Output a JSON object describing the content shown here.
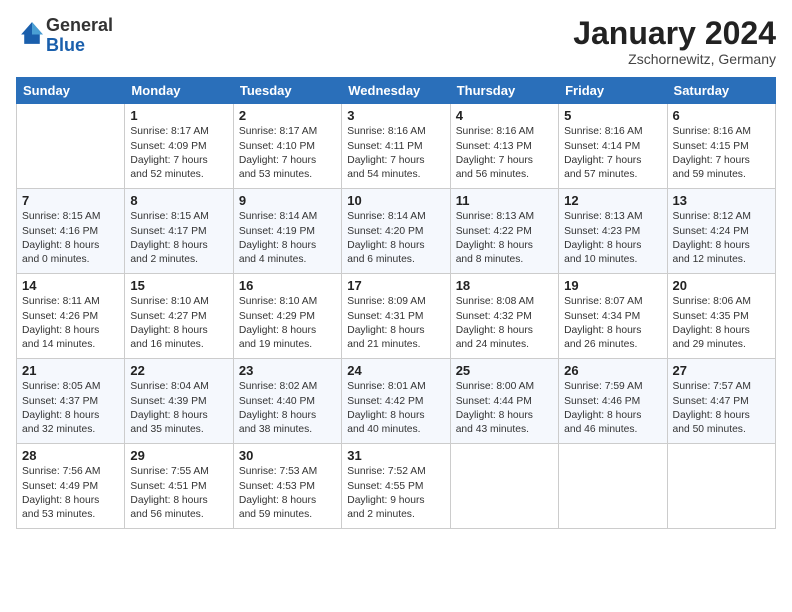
{
  "header": {
    "logo_general": "General",
    "logo_blue": "Blue",
    "month_title": "January 2024",
    "subtitle": "Zschornewitz, Germany"
  },
  "days_of_week": [
    "Sunday",
    "Monday",
    "Tuesday",
    "Wednesday",
    "Thursday",
    "Friday",
    "Saturday"
  ],
  "weeks": [
    [
      {
        "day": "",
        "lines": []
      },
      {
        "day": "1",
        "lines": [
          "Sunrise: 8:17 AM",
          "Sunset: 4:09 PM",
          "Daylight: 7 hours",
          "and 52 minutes."
        ]
      },
      {
        "day": "2",
        "lines": [
          "Sunrise: 8:17 AM",
          "Sunset: 4:10 PM",
          "Daylight: 7 hours",
          "and 53 minutes."
        ]
      },
      {
        "day": "3",
        "lines": [
          "Sunrise: 8:16 AM",
          "Sunset: 4:11 PM",
          "Daylight: 7 hours",
          "and 54 minutes."
        ]
      },
      {
        "day": "4",
        "lines": [
          "Sunrise: 8:16 AM",
          "Sunset: 4:13 PM",
          "Daylight: 7 hours",
          "and 56 minutes."
        ]
      },
      {
        "day": "5",
        "lines": [
          "Sunrise: 8:16 AM",
          "Sunset: 4:14 PM",
          "Daylight: 7 hours",
          "and 57 minutes."
        ]
      },
      {
        "day": "6",
        "lines": [
          "Sunrise: 8:16 AM",
          "Sunset: 4:15 PM",
          "Daylight: 7 hours",
          "and 59 minutes."
        ]
      }
    ],
    [
      {
        "day": "7",
        "lines": [
          "Sunrise: 8:15 AM",
          "Sunset: 4:16 PM",
          "Daylight: 8 hours",
          "and 0 minutes."
        ]
      },
      {
        "day": "8",
        "lines": [
          "Sunrise: 8:15 AM",
          "Sunset: 4:17 PM",
          "Daylight: 8 hours",
          "and 2 minutes."
        ]
      },
      {
        "day": "9",
        "lines": [
          "Sunrise: 8:14 AM",
          "Sunset: 4:19 PM",
          "Daylight: 8 hours",
          "and 4 minutes."
        ]
      },
      {
        "day": "10",
        "lines": [
          "Sunrise: 8:14 AM",
          "Sunset: 4:20 PM",
          "Daylight: 8 hours",
          "and 6 minutes."
        ]
      },
      {
        "day": "11",
        "lines": [
          "Sunrise: 8:13 AM",
          "Sunset: 4:22 PM",
          "Daylight: 8 hours",
          "and 8 minutes."
        ]
      },
      {
        "day": "12",
        "lines": [
          "Sunrise: 8:13 AM",
          "Sunset: 4:23 PM",
          "Daylight: 8 hours",
          "and 10 minutes."
        ]
      },
      {
        "day": "13",
        "lines": [
          "Sunrise: 8:12 AM",
          "Sunset: 4:24 PM",
          "Daylight: 8 hours",
          "and 12 minutes."
        ]
      }
    ],
    [
      {
        "day": "14",
        "lines": [
          "Sunrise: 8:11 AM",
          "Sunset: 4:26 PM",
          "Daylight: 8 hours",
          "and 14 minutes."
        ]
      },
      {
        "day": "15",
        "lines": [
          "Sunrise: 8:10 AM",
          "Sunset: 4:27 PM",
          "Daylight: 8 hours",
          "and 16 minutes."
        ]
      },
      {
        "day": "16",
        "lines": [
          "Sunrise: 8:10 AM",
          "Sunset: 4:29 PM",
          "Daylight: 8 hours",
          "and 19 minutes."
        ]
      },
      {
        "day": "17",
        "lines": [
          "Sunrise: 8:09 AM",
          "Sunset: 4:31 PM",
          "Daylight: 8 hours",
          "and 21 minutes."
        ]
      },
      {
        "day": "18",
        "lines": [
          "Sunrise: 8:08 AM",
          "Sunset: 4:32 PM",
          "Daylight: 8 hours",
          "and 24 minutes."
        ]
      },
      {
        "day": "19",
        "lines": [
          "Sunrise: 8:07 AM",
          "Sunset: 4:34 PM",
          "Daylight: 8 hours",
          "and 26 minutes."
        ]
      },
      {
        "day": "20",
        "lines": [
          "Sunrise: 8:06 AM",
          "Sunset: 4:35 PM",
          "Daylight: 8 hours",
          "and 29 minutes."
        ]
      }
    ],
    [
      {
        "day": "21",
        "lines": [
          "Sunrise: 8:05 AM",
          "Sunset: 4:37 PM",
          "Daylight: 8 hours",
          "and 32 minutes."
        ]
      },
      {
        "day": "22",
        "lines": [
          "Sunrise: 8:04 AM",
          "Sunset: 4:39 PM",
          "Daylight: 8 hours",
          "and 35 minutes."
        ]
      },
      {
        "day": "23",
        "lines": [
          "Sunrise: 8:02 AM",
          "Sunset: 4:40 PM",
          "Daylight: 8 hours",
          "and 38 minutes."
        ]
      },
      {
        "day": "24",
        "lines": [
          "Sunrise: 8:01 AM",
          "Sunset: 4:42 PM",
          "Daylight: 8 hours",
          "and 40 minutes."
        ]
      },
      {
        "day": "25",
        "lines": [
          "Sunrise: 8:00 AM",
          "Sunset: 4:44 PM",
          "Daylight: 8 hours",
          "and 43 minutes."
        ]
      },
      {
        "day": "26",
        "lines": [
          "Sunrise: 7:59 AM",
          "Sunset: 4:46 PM",
          "Daylight: 8 hours",
          "and 46 minutes."
        ]
      },
      {
        "day": "27",
        "lines": [
          "Sunrise: 7:57 AM",
          "Sunset: 4:47 PM",
          "Daylight: 8 hours",
          "and 50 minutes."
        ]
      }
    ],
    [
      {
        "day": "28",
        "lines": [
          "Sunrise: 7:56 AM",
          "Sunset: 4:49 PM",
          "Daylight: 8 hours",
          "and 53 minutes."
        ]
      },
      {
        "day": "29",
        "lines": [
          "Sunrise: 7:55 AM",
          "Sunset: 4:51 PM",
          "Daylight: 8 hours",
          "and 56 minutes."
        ]
      },
      {
        "day": "30",
        "lines": [
          "Sunrise: 7:53 AM",
          "Sunset: 4:53 PM",
          "Daylight: 8 hours",
          "and 59 minutes."
        ]
      },
      {
        "day": "31",
        "lines": [
          "Sunrise: 7:52 AM",
          "Sunset: 4:55 PM",
          "Daylight: 9 hours",
          "and 2 minutes."
        ]
      },
      {
        "day": "",
        "lines": []
      },
      {
        "day": "",
        "lines": []
      },
      {
        "day": "",
        "lines": []
      }
    ]
  ]
}
